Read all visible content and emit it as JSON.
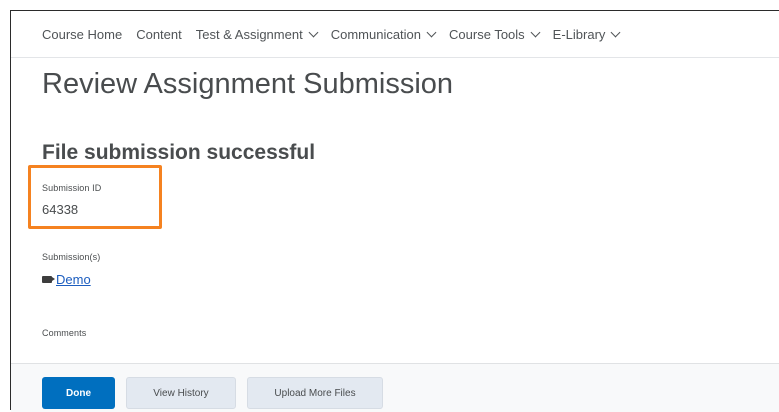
{
  "nav": {
    "items": [
      {
        "label": "Course Home",
        "dropdown": false
      },
      {
        "label": "Content",
        "dropdown": false
      },
      {
        "label": "Test & Assignment",
        "dropdown": true
      },
      {
        "label": "Communication",
        "dropdown": true
      },
      {
        "label": "Course Tools",
        "dropdown": true
      },
      {
        "label": "E-Library",
        "dropdown": true
      }
    ]
  },
  "page": {
    "title": "Review Assignment Submission",
    "subtitle": "File submission successful"
  },
  "submission": {
    "id_label": "Submission ID",
    "id_value": "64338",
    "files_label": "Submission(s)",
    "file_name": "Demo",
    "comments_label": "Comments"
  },
  "footer": {
    "done_label": "Done",
    "history_label": "View History",
    "upload_label": "Upload More Files"
  },
  "colors": {
    "highlight": "#f58220",
    "primary_button": "#006fbf",
    "link": "#1c5dbf"
  }
}
